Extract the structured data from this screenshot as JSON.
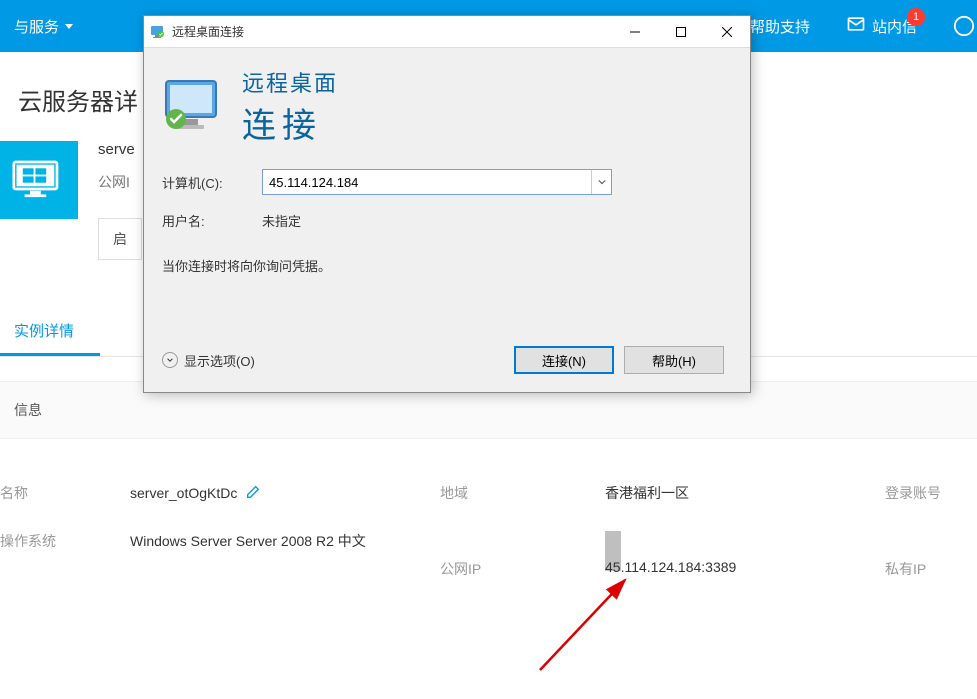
{
  "topnav": {
    "products_label": "与服务",
    "help_label": "帮助支持",
    "mail_label": "站内信",
    "badge_count": "1"
  },
  "page": {
    "title": "云服务器详"
  },
  "server": {
    "name_prefix": "serve",
    "ip_label_prefix": "公网I",
    "action_btn": "启"
  },
  "tabs": {
    "detail": "实例详情"
  },
  "section": {
    "info": "信息"
  },
  "details": {
    "name_label": "名称",
    "name_value": "server_otOgKtDc",
    "region_label": "地域",
    "region_value": "香港福利一区",
    "login_label": "登录账号",
    "os_label": "操作系统",
    "os_value": "Windows Server Server 2008 R2 中文",
    "public_ip_label": "公网IP",
    "public_ip_value": "45.114.124.184:3389",
    "private_ip_label": "私有IP"
  },
  "dialog": {
    "title": "远程桌面连接",
    "header_line1": "远程桌面",
    "header_line2": "连接",
    "computer_label": "计算机(C):",
    "computer_value": "45.114.124.184",
    "user_label": "用户名:",
    "user_value": "未指定",
    "credential_note": "当你连接时将向你询问凭据。",
    "show_options": "显示选项(O)",
    "connect_btn": "连接(N)",
    "help_btn": "帮助(H)"
  }
}
